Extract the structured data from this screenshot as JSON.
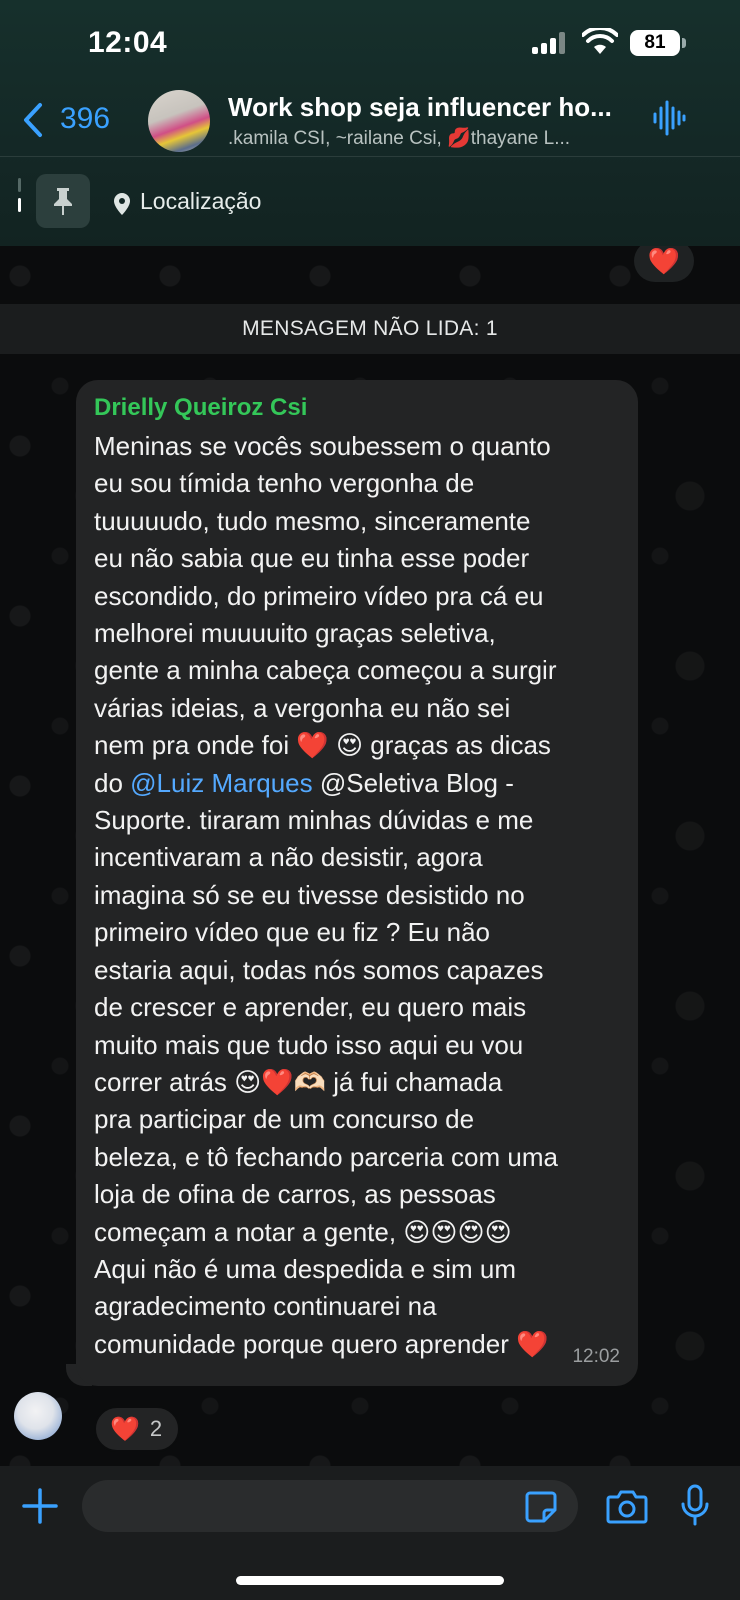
{
  "status_bar": {
    "time": "12:04",
    "battery": "81"
  },
  "header": {
    "back_count": "396",
    "title": "Work shop seja influencer ho...",
    "members": ".kamila CSI, ~railane  Csi, 💋thayane L...",
    "pinned_label": "Localização"
  },
  "chat": {
    "top_reaction": "❤️",
    "unread_banner": "MENSAGEM NÃO LIDA: 1",
    "message": {
      "sender": "Drielly Queiroz Csi",
      "timestamp": "12:02",
      "lines": [
        "Meninas se vocês soubessem o quanto",
        "eu sou tímida tenho vergonha de",
        "tuuuuudo, tudo mesmo, sinceramente",
        "eu não sabia que eu tinha esse poder",
        "escondido, do primeiro vídeo pra cá eu",
        "melhorei muuuuito graças seletiva,",
        "gente a minha cabeça começou a surgir",
        "várias ideias, a vergonha eu não sei",
        "nem pra onde foi ❤️ 😍 graças as dicas",
        "do ",
        "Suporte. tiraram minhas dúvidas e me",
        "incentivaram a não desistir, agora",
        "imagina só se eu tivesse desistido no",
        "primeiro vídeo que eu fiz ? Eu não",
        "estaria aqui, todas nós somos capazes",
        "de crescer e aprender, eu quero mais",
        "muito mais que tudo isso aqui eu vou",
        "correr atrás 😍❤️🫶🏻 já fui chamada",
        "pra participar de um concurso de",
        "beleza, e tô fechando parceria com uma",
        "loja de ofina de carros, as pessoas",
        "começam a notar a gente, 😍😍😍😍",
        "Aqui não é uma despedida e sim um",
        "agradecimento continuarei na",
        "comunidade porque quero aprender ❤️"
      ],
      "mention": "@Luiz Marques",
      "after_mention": " @Seletiva Blog -"
    },
    "reaction": {
      "emoji": "❤️",
      "count": "2"
    }
  },
  "composer": {
    "placeholder": ""
  },
  "colors": {
    "accent_blue": "#3aa1ff",
    "sender_green": "#34c759",
    "mention_blue": "#54a9ff",
    "bubble": "#232425"
  }
}
